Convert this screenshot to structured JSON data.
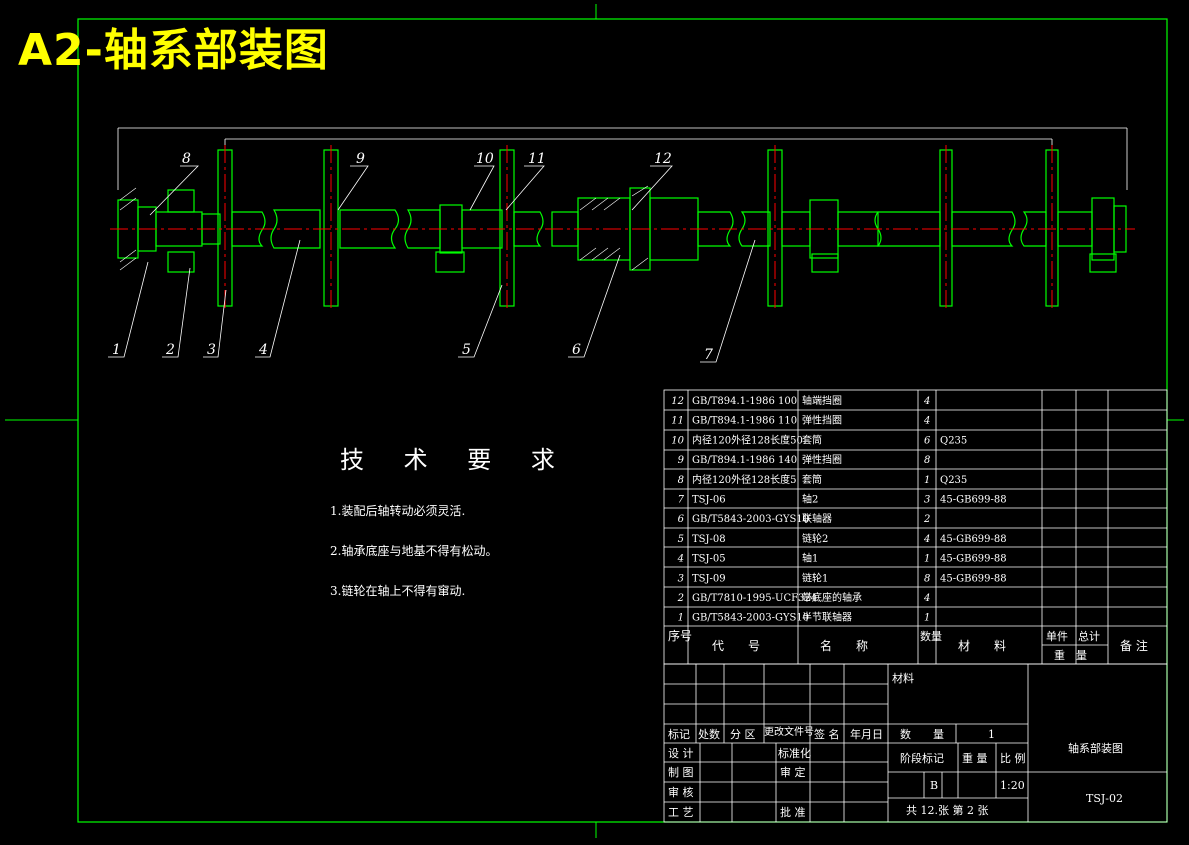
{
  "header": {
    "title": "A2-轴系部装图"
  },
  "tech_requirements": {
    "heading": "技 术 要 求",
    "items": [
      "1.装配后轴转动必须灵活.",
      "2.轴承底座与地基不得有松动。",
      "3.链轮在轴上不得有窜动."
    ]
  },
  "callouts": [
    "1",
    "2",
    "3",
    "4",
    "5",
    "6",
    "7",
    "8",
    "9",
    "10",
    "11",
    "12"
  ],
  "bom": {
    "rows": [
      {
        "no": "12",
        "code": "GB/T894.1-1986 100",
        "name": "轴端挡圈",
        "qty": "4",
        "material": ""
      },
      {
        "no": "11",
        "code": "GB/T894.1-1986 110",
        "name": "弹性挡圈",
        "qty": "4",
        "material": ""
      },
      {
        "no": "10",
        "code": "内径120外径128长度50",
        "name": "套筒",
        "qty": "6",
        "material": "Q235"
      },
      {
        "no": "9",
        "code": "GB/T894.1-1986 140",
        "name": "弹性挡圈",
        "qty": "8",
        "material": ""
      },
      {
        "no": "8",
        "code": "内径120外径128长度5",
        "name": "套筒",
        "qty": "1",
        "material": "Q235"
      },
      {
        "no": "7",
        "code": "TSJ-06",
        "name": "轴2",
        "qty": "3",
        "material": "45-GB699-88"
      },
      {
        "no": "6",
        "code": "GB/T5843-2003-GYS10",
        "name": "联轴器",
        "qty": "2",
        "material": ""
      },
      {
        "no": "5",
        "code": "TSJ-08",
        "name": "链轮2",
        "qty": "4",
        "material": "45-GB699-88"
      },
      {
        "no": "4",
        "code": "TSJ-05",
        "name": "轴1",
        "qty": "1",
        "material": "45-GB699-88"
      },
      {
        "no": "3",
        "code": "TSJ-09",
        "name": "链轮1",
        "qty": "8",
        "material": "45-GB699-88"
      },
      {
        "no": "2",
        "code": "GB/T7810-1995-UCF324",
        "name": "带底座的轴承",
        "qty": "4",
        "material": ""
      },
      {
        "no": "1",
        "code": "GB/T5843-2003-GYS10",
        "name": "半节联轴器",
        "qty": "1",
        "material": ""
      }
    ],
    "header": {
      "no": "序号",
      "code": "代　　号",
      "name": "名　　称",
      "qty": "数量",
      "material": "材　　料",
      "unit": "单件",
      "total": "总计",
      "weight": "重　量",
      "remark": "备 注"
    }
  },
  "titleblock": {
    "material_label": "材料",
    "row_labels": [
      "标记",
      "处数",
      "分 区",
      "更改文件号",
      "签 名",
      "年月日"
    ],
    "design": "设 计",
    "standard": "标准化",
    "draw": "制 图",
    "review": "审 定",
    "check": "审 核",
    "process": "工 艺",
    "approve": "批 准",
    "qty_label": "数　　量",
    "qty_value": "1",
    "stage_label": "阶段标记",
    "weight_label": "重 量",
    "scale_label": "比 例",
    "stage_value": "B",
    "scale_value": "1:20",
    "sheets": "共 12.张 第 2 张",
    "drawing_name": "轴系部装图",
    "drawing_no": "TSJ-02"
  },
  "colors": {
    "frame": "#00ff00",
    "centerline": "#ff0000",
    "text": "#ffffff",
    "title": "#ffff00",
    "accent": "#ffff00"
  }
}
